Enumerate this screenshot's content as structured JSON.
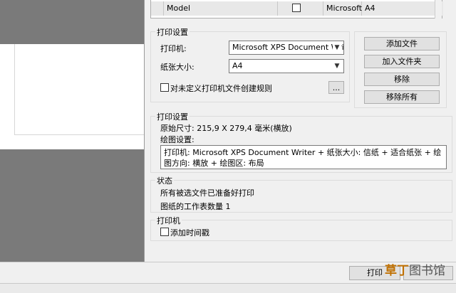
{
  "file_list": {
    "row": {
      "name": "Model",
      "checked": false,
      "printer": "Microsoft",
      "paper": "A4"
    }
  },
  "print_setup": {
    "title": "打印设置",
    "printer_label": "打印机:",
    "printer_value": "Microsoft XPS Document Writ",
    "paper_label": "纸张大小:",
    "paper_value": "A4",
    "rule_checkbox_label": "对未定义打印机文件创建规则",
    "ellipsis": "..."
  },
  "file_buttons": {
    "add_file": "添加文件",
    "add_folder": "加入文件夹",
    "remove": "移除",
    "remove_all": "移除所有"
  },
  "print_settings": {
    "title": "打印设置",
    "original_size": "原始尺寸: 215,9 X 279,4 毫米(横放)",
    "plot_settings_label": "绘图设置:",
    "plot_settings_text": "打印机: Microsoft XPS Document Writer + 纸张大小: 信纸 + 适合纸张 + 绘图方向: 横放 + 绘图区: 布局"
  },
  "status": {
    "title": "状态",
    "line1": "所有被选文件已准备好打印",
    "line2": "图纸的工作表数量 1"
  },
  "printer_group": {
    "title": "打印机",
    "timestamp_label": "添加时间戳"
  },
  "footer": {
    "print_button": "打印"
  },
  "watermark": {
    "brand": "草丁",
    "suffix": "图书馆"
  }
}
